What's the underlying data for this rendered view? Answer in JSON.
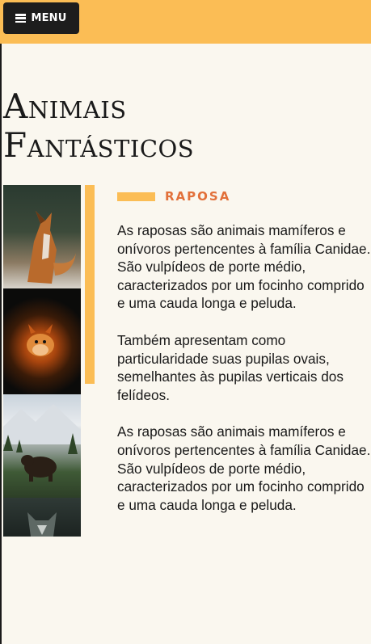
{
  "header": {
    "menu_label": "MENU",
    "menu_icon": "hamburger-icon",
    "color": "#fbbd55"
  },
  "page": {
    "title_line1": "Animais",
    "title_line2": "Fantásticos",
    "background": "#faf7ef"
  },
  "gallery": {
    "photos": [
      "fox-photo",
      "red-squirrel-photo",
      "bear-photo",
      "wolf-photo"
    ]
  },
  "section": {
    "tag": "RAPOSA",
    "tag_color": "#e2703a",
    "paragraphs": [
      "As raposas são animais mamíferos e onívoros pertencentes à família Canidae. São vulpídeos de porte médio, caracterizados por um focinho comprido e uma cauda longa e peluda.",
      "Também apresentam como particularidade suas pupilas ovais, semelhantes às pupilas verticais dos felídeos.",
      "As raposas são animais mamíferos e onívoros pertencentes à família Canidae. São vulpídeos de porte médio, caracterizados por um focinho comprido e uma cauda longa e peluda."
    ]
  }
}
